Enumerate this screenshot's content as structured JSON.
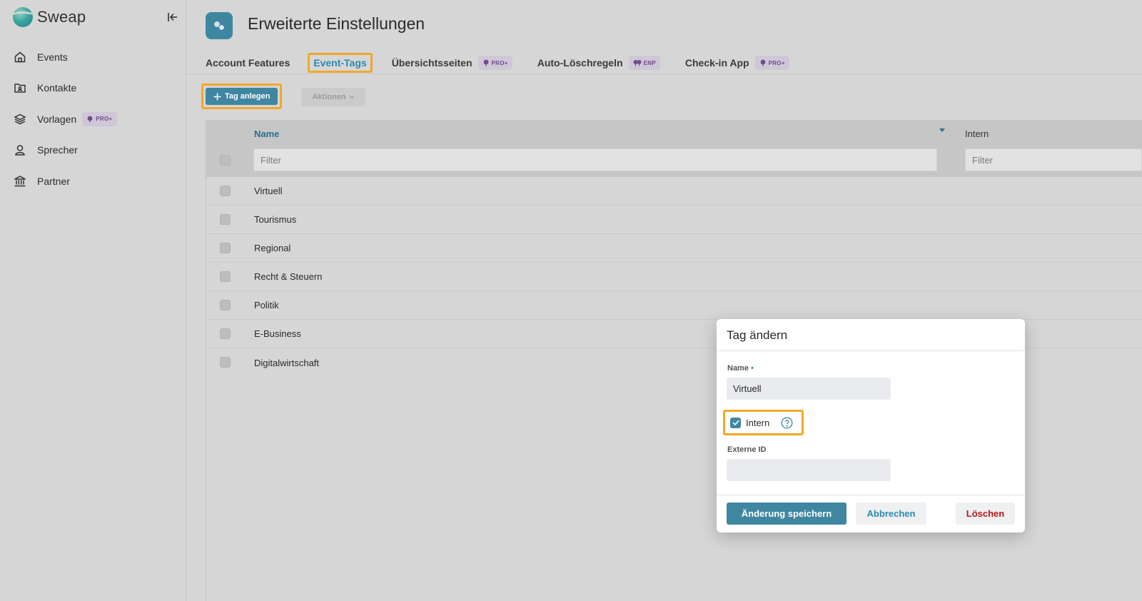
{
  "app": {
    "name": "Sweap"
  },
  "sidebar": {
    "items": [
      {
        "label": "Events",
        "icon": "home-icon"
      },
      {
        "label": "Kontakte",
        "icon": "contacts-folder-icon"
      },
      {
        "label": "Vorlagen",
        "icon": "layers-icon",
        "badge": "PRO+"
      },
      {
        "label": "Sprecher",
        "icon": "speaker-person-icon"
      },
      {
        "label": "Partner",
        "icon": "bank-building-icon"
      }
    ]
  },
  "header": {
    "title": "Erweiterte Einstellungen",
    "icon": "settings-gears-icon"
  },
  "tabs": [
    {
      "label": "Account Features",
      "active": false
    },
    {
      "label": "Event-Tags",
      "active": true
    },
    {
      "label": "Übersichtsseiten",
      "badge": "PRO+"
    },
    {
      "label": "Auto-Löschregeln",
      "badge": "ENP"
    },
    {
      "label": "Check-in App",
      "badge": "PRO+"
    }
  ],
  "toolbar": {
    "create_label": "Tag anlegen",
    "actions_label": "Aktionen"
  },
  "table": {
    "columns": {
      "name": "Name",
      "intern": "Intern"
    },
    "filter_placeholder": "Filter",
    "rows": [
      "Virtuell",
      "Tourismus",
      "Regional",
      "Recht & Steuern",
      "Politik",
      "E-Business",
      "Digitalwirtschaft"
    ]
  },
  "modal": {
    "title": "Tag ändern",
    "name_label": "Name",
    "required_mark": "•",
    "name_value": "Virtuell",
    "intern_label": "Intern",
    "intern_checked": true,
    "external_id_label": "Externe ID",
    "external_id_value": "",
    "save_label": "Änderung speichern",
    "cancel_label": "Abbrechen",
    "delete_label": "Löschen"
  },
  "colors": {
    "accent": "#3f87a0",
    "highlight": "#f0a82a",
    "danger": "#c01818",
    "badge_text": "#6b4e8a"
  }
}
